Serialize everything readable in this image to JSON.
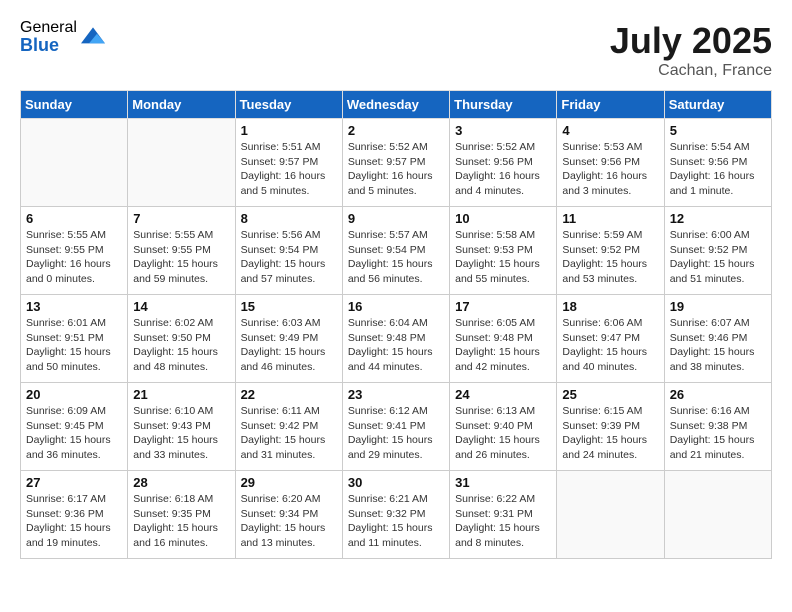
{
  "header": {
    "logo_general": "General",
    "logo_blue": "Blue",
    "month_title": "July 2025",
    "location": "Cachan, France"
  },
  "calendar": {
    "days_of_week": [
      "Sunday",
      "Monday",
      "Tuesday",
      "Wednesday",
      "Thursday",
      "Friday",
      "Saturday"
    ],
    "weeks": [
      [
        {
          "day": "",
          "info": ""
        },
        {
          "day": "",
          "info": ""
        },
        {
          "day": "1",
          "info": "Sunrise: 5:51 AM\nSunset: 9:57 PM\nDaylight: 16 hours and 5 minutes."
        },
        {
          "day": "2",
          "info": "Sunrise: 5:52 AM\nSunset: 9:57 PM\nDaylight: 16 hours and 5 minutes."
        },
        {
          "day": "3",
          "info": "Sunrise: 5:52 AM\nSunset: 9:56 PM\nDaylight: 16 hours and 4 minutes."
        },
        {
          "day": "4",
          "info": "Sunrise: 5:53 AM\nSunset: 9:56 PM\nDaylight: 16 hours and 3 minutes."
        },
        {
          "day": "5",
          "info": "Sunrise: 5:54 AM\nSunset: 9:56 PM\nDaylight: 16 hours and 1 minute."
        }
      ],
      [
        {
          "day": "6",
          "info": "Sunrise: 5:55 AM\nSunset: 9:55 PM\nDaylight: 16 hours and 0 minutes."
        },
        {
          "day": "7",
          "info": "Sunrise: 5:55 AM\nSunset: 9:55 PM\nDaylight: 15 hours and 59 minutes."
        },
        {
          "day": "8",
          "info": "Sunrise: 5:56 AM\nSunset: 9:54 PM\nDaylight: 15 hours and 57 minutes."
        },
        {
          "day": "9",
          "info": "Sunrise: 5:57 AM\nSunset: 9:54 PM\nDaylight: 15 hours and 56 minutes."
        },
        {
          "day": "10",
          "info": "Sunrise: 5:58 AM\nSunset: 9:53 PM\nDaylight: 15 hours and 55 minutes."
        },
        {
          "day": "11",
          "info": "Sunrise: 5:59 AM\nSunset: 9:52 PM\nDaylight: 15 hours and 53 minutes."
        },
        {
          "day": "12",
          "info": "Sunrise: 6:00 AM\nSunset: 9:52 PM\nDaylight: 15 hours and 51 minutes."
        }
      ],
      [
        {
          "day": "13",
          "info": "Sunrise: 6:01 AM\nSunset: 9:51 PM\nDaylight: 15 hours and 50 minutes."
        },
        {
          "day": "14",
          "info": "Sunrise: 6:02 AM\nSunset: 9:50 PM\nDaylight: 15 hours and 48 minutes."
        },
        {
          "day": "15",
          "info": "Sunrise: 6:03 AM\nSunset: 9:49 PM\nDaylight: 15 hours and 46 minutes."
        },
        {
          "day": "16",
          "info": "Sunrise: 6:04 AM\nSunset: 9:48 PM\nDaylight: 15 hours and 44 minutes."
        },
        {
          "day": "17",
          "info": "Sunrise: 6:05 AM\nSunset: 9:48 PM\nDaylight: 15 hours and 42 minutes."
        },
        {
          "day": "18",
          "info": "Sunrise: 6:06 AM\nSunset: 9:47 PM\nDaylight: 15 hours and 40 minutes."
        },
        {
          "day": "19",
          "info": "Sunrise: 6:07 AM\nSunset: 9:46 PM\nDaylight: 15 hours and 38 minutes."
        }
      ],
      [
        {
          "day": "20",
          "info": "Sunrise: 6:09 AM\nSunset: 9:45 PM\nDaylight: 15 hours and 36 minutes."
        },
        {
          "day": "21",
          "info": "Sunrise: 6:10 AM\nSunset: 9:43 PM\nDaylight: 15 hours and 33 minutes."
        },
        {
          "day": "22",
          "info": "Sunrise: 6:11 AM\nSunset: 9:42 PM\nDaylight: 15 hours and 31 minutes."
        },
        {
          "day": "23",
          "info": "Sunrise: 6:12 AM\nSunset: 9:41 PM\nDaylight: 15 hours and 29 minutes."
        },
        {
          "day": "24",
          "info": "Sunrise: 6:13 AM\nSunset: 9:40 PM\nDaylight: 15 hours and 26 minutes."
        },
        {
          "day": "25",
          "info": "Sunrise: 6:15 AM\nSunset: 9:39 PM\nDaylight: 15 hours and 24 minutes."
        },
        {
          "day": "26",
          "info": "Sunrise: 6:16 AM\nSunset: 9:38 PM\nDaylight: 15 hours and 21 minutes."
        }
      ],
      [
        {
          "day": "27",
          "info": "Sunrise: 6:17 AM\nSunset: 9:36 PM\nDaylight: 15 hours and 19 minutes."
        },
        {
          "day": "28",
          "info": "Sunrise: 6:18 AM\nSunset: 9:35 PM\nDaylight: 15 hours and 16 minutes."
        },
        {
          "day": "29",
          "info": "Sunrise: 6:20 AM\nSunset: 9:34 PM\nDaylight: 15 hours and 13 minutes."
        },
        {
          "day": "30",
          "info": "Sunrise: 6:21 AM\nSunset: 9:32 PM\nDaylight: 15 hours and 11 minutes."
        },
        {
          "day": "31",
          "info": "Sunrise: 6:22 AM\nSunset: 9:31 PM\nDaylight: 15 hours and 8 minutes."
        },
        {
          "day": "",
          "info": ""
        },
        {
          "day": "",
          "info": ""
        }
      ]
    ]
  }
}
